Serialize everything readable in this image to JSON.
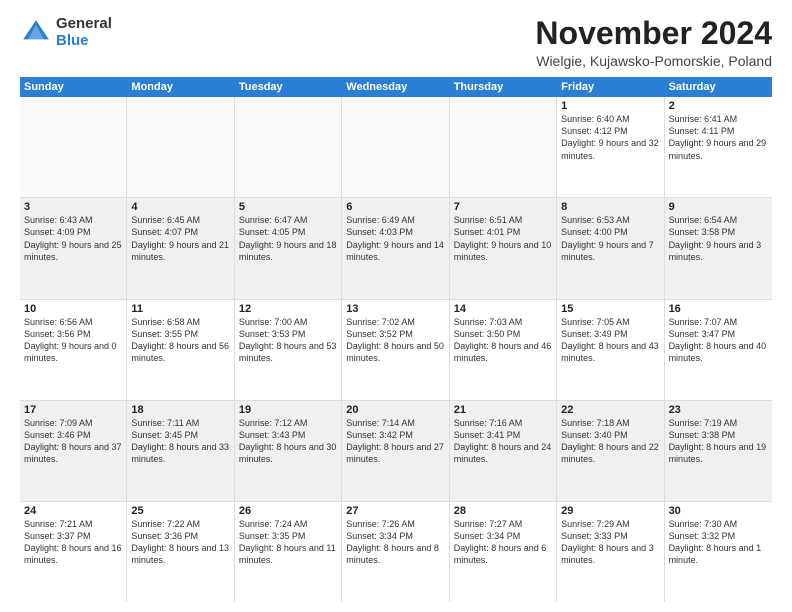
{
  "logo": {
    "general": "General",
    "blue": "Blue"
  },
  "title": "November 2024",
  "location": "Wielgie, Kujawsko-Pomorskie, Poland",
  "days": [
    "Sunday",
    "Monday",
    "Tuesday",
    "Wednesday",
    "Thursday",
    "Friday",
    "Saturday"
  ],
  "rows": [
    [
      {
        "day": "",
        "info": ""
      },
      {
        "day": "",
        "info": ""
      },
      {
        "day": "",
        "info": ""
      },
      {
        "day": "",
        "info": ""
      },
      {
        "day": "",
        "info": ""
      },
      {
        "day": "1",
        "info": "Sunrise: 6:40 AM\nSunset: 4:12 PM\nDaylight: 9 hours and 32 minutes."
      },
      {
        "day": "2",
        "info": "Sunrise: 6:41 AM\nSunset: 4:11 PM\nDaylight: 9 hours and 29 minutes."
      }
    ],
    [
      {
        "day": "3",
        "info": "Sunrise: 6:43 AM\nSunset: 4:09 PM\nDaylight: 9 hours and 25 minutes."
      },
      {
        "day": "4",
        "info": "Sunrise: 6:45 AM\nSunset: 4:07 PM\nDaylight: 9 hours and 21 minutes."
      },
      {
        "day": "5",
        "info": "Sunrise: 6:47 AM\nSunset: 4:05 PM\nDaylight: 9 hours and 18 minutes."
      },
      {
        "day": "6",
        "info": "Sunrise: 6:49 AM\nSunset: 4:03 PM\nDaylight: 9 hours and 14 minutes."
      },
      {
        "day": "7",
        "info": "Sunrise: 6:51 AM\nSunset: 4:01 PM\nDaylight: 9 hours and 10 minutes."
      },
      {
        "day": "8",
        "info": "Sunrise: 6:53 AM\nSunset: 4:00 PM\nDaylight: 9 hours and 7 minutes."
      },
      {
        "day": "9",
        "info": "Sunrise: 6:54 AM\nSunset: 3:58 PM\nDaylight: 9 hours and 3 minutes."
      }
    ],
    [
      {
        "day": "10",
        "info": "Sunrise: 6:56 AM\nSunset: 3:56 PM\nDaylight: 9 hours and 0 minutes."
      },
      {
        "day": "11",
        "info": "Sunrise: 6:58 AM\nSunset: 3:55 PM\nDaylight: 8 hours and 56 minutes."
      },
      {
        "day": "12",
        "info": "Sunrise: 7:00 AM\nSunset: 3:53 PM\nDaylight: 8 hours and 53 minutes."
      },
      {
        "day": "13",
        "info": "Sunrise: 7:02 AM\nSunset: 3:52 PM\nDaylight: 8 hours and 50 minutes."
      },
      {
        "day": "14",
        "info": "Sunrise: 7:03 AM\nSunset: 3:50 PM\nDaylight: 8 hours and 46 minutes."
      },
      {
        "day": "15",
        "info": "Sunrise: 7:05 AM\nSunset: 3:49 PM\nDaylight: 8 hours and 43 minutes."
      },
      {
        "day": "16",
        "info": "Sunrise: 7:07 AM\nSunset: 3:47 PM\nDaylight: 8 hours and 40 minutes."
      }
    ],
    [
      {
        "day": "17",
        "info": "Sunrise: 7:09 AM\nSunset: 3:46 PM\nDaylight: 8 hours and 37 minutes."
      },
      {
        "day": "18",
        "info": "Sunrise: 7:11 AM\nSunset: 3:45 PM\nDaylight: 8 hours and 33 minutes."
      },
      {
        "day": "19",
        "info": "Sunrise: 7:12 AM\nSunset: 3:43 PM\nDaylight: 8 hours and 30 minutes."
      },
      {
        "day": "20",
        "info": "Sunrise: 7:14 AM\nSunset: 3:42 PM\nDaylight: 8 hours and 27 minutes."
      },
      {
        "day": "21",
        "info": "Sunrise: 7:16 AM\nSunset: 3:41 PM\nDaylight: 8 hours and 24 minutes."
      },
      {
        "day": "22",
        "info": "Sunrise: 7:18 AM\nSunset: 3:40 PM\nDaylight: 8 hours and 22 minutes."
      },
      {
        "day": "23",
        "info": "Sunrise: 7:19 AM\nSunset: 3:38 PM\nDaylight: 8 hours and 19 minutes."
      }
    ],
    [
      {
        "day": "24",
        "info": "Sunrise: 7:21 AM\nSunset: 3:37 PM\nDaylight: 8 hours and 16 minutes."
      },
      {
        "day": "25",
        "info": "Sunrise: 7:22 AM\nSunset: 3:36 PM\nDaylight: 8 hours and 13 minutes."
      },
      {
        "day": "26",
        "info": "Sunrise: 7:24 AM\nSunset: 3:35 PM\nDaylight: 8 hours and 11 minutes."
      },
      {
        "day": "27",
        "info": "Sunrise: 7:26 AM\nSunset: 3:34 PM\nDaylight: 8 hours and 8 minutes."
      },
      {
        "day": "28",
        "info": "Sunrise: 7:27 AM\nSunset: 3:34 PM\nDaylight: 8 hours and 6 minutes."
      },
      {
        "day": "29",
        "info": "Sunrise: 7:29 AM\nSunset: 3:33 PM\nDaylight: 8 hours and 3 minutes."
      },
      {
        "day": "30",
        "info": "Sunrise: 7:30 AM\nSunset: 3:32 PM\nDaylight: 8 hours and 1 minute."
      }
    ]
  ]
}
